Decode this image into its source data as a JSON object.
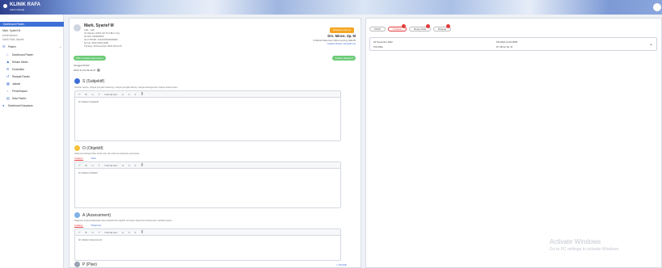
{
  "app": {
    "name": "KLINIK RAFA",
    "tagline": "Admin Dental"
  },
  "sidebar": {
    "active_label": "Dashboard Pasien",
    "user_name": "Mark. Syarief M",
    "user_role": "Administrator",
    "user_sub": "Klinik Rafa Jakarta",
    "section_label": "Pasien",
    "items": [
      {
        "label": "Dashboard Pasien",
        "icon": "home-icon"
      },
      {
        "label": "Rekam Medis",
        "icon": "person-icon"
      },
      {
        "label": "Konsultasi",
        "icon": "chat-icon"
      },
      {
        "label": "Riwayat Pasien",
        "icon": "history-icon"
      },
      {
        "label": "Jadwal",
        "icon": "calendar-icon"
      },
      {
        "label": "Pemeriksaan",
        "icon": "stethoscope-icon"
      },
      {
        "label": "Data Pasien",
        "icon": "folder-icon"
      },
      {
        "label": "Dashboard Karyawan",
        "icon": "users-icon"
      }
    ]
  },
  "patient": {
    "name": "Mark. Syarief M",
    "info_lines": [
      "Laki - Laki",
      "31 Oktober 2003 (19 Th 0 Bln 2 Hr)",
      "No RM: 000000005",
      "No KTP/NIK: 3201070000000000",
      "No Hp: 0812-0000-0000",
      "Tgl Reg: 29 November 2022 09:42:37"
    ],
    "action_button": "Riwayat Lainnya"
  },
  "doctor": {
    "name": "Drs. Mince, Sp. M",
    "lines": [
      "Poliklinik Mata Kami Mitra Gonting Rafa Bl",
      "Catatan Rekam Hospital List"
    ]
  },
  "controls": {
    "template_pill": "Pilih Template Anamnesa",
    "history_pill": "Catatan Riwayat",
    "date_label": "Tanggal SOAP",
    "date_value": "2022-11-29 09:42:37"
  },
  "sections": [
    {
      "title": "S (Subjektif)",
      "desc": "Keluhan utama, riwayat penyakit sekarang, riwayat penyakit dahulu, riwayat keluarga dan riwayat sosial pasien.",
      "content": "Isi Catatan Subjektif"
    },
    {
      "title": "O (Objektif)",
      "desc": "Hasil pemeriksaan fisik, tanda vital, dan hasil pemeriksaan penunjang.",
      "tabs": [
        "Catatan",
        "Vital"
      ],
      "content": "Isi Catatan Objektif"
    },
    {
      "title": "A (Assessment)",
      "desc": "Diagnosis kerja berdasarkan data subjektif dan objektif, termasuk diagnosis banding dan masalah pasien.",
      "tabs": [
        "Catatan",
        "Diagnosa"
      ],
      "content": "Isi Catatan Assessment"
    },
    {
      "title": "P (Plan)",
      "link": "+ Tambah"
    }
  ],
  "editor_toolbar": [
    "↶",
    "B",
    "U",
    "T",
    "Normal text",
    "A",
    "≡",
    "≡",
    "≣"
  ],
  "right_panel": {
    "tabs": [
      {
        "label": "SOAP",
        "active": false,
        "dot": false
      },
      {
        "label": "Tindakan",
        "active": true,
        "dot": true
      },
      {
        "label": "Resep Obat",
        "active": false,
        "dot": true
      },
      {
        "label": "Riwayat",
        "active": false,
        "dot": true
      }
    ],
    "record": {
      "date": "29 November 2022",
      "place": "Poli Mata",
      "code": "KR-2022-11-29-0005",
      "doctor": "Dr. Mince Sp. M"
    }
  },
  "watermark": {
    "title": "Activate Windows",
    "subtitle": "Go to PC settings to activate Windows."
  },
  "colors": {
    "accent": "#3d6fd6",
    "orange": "#f5a623",
    "green": "#6ccb77",
    "red": "#e23b3b"
  }
}
